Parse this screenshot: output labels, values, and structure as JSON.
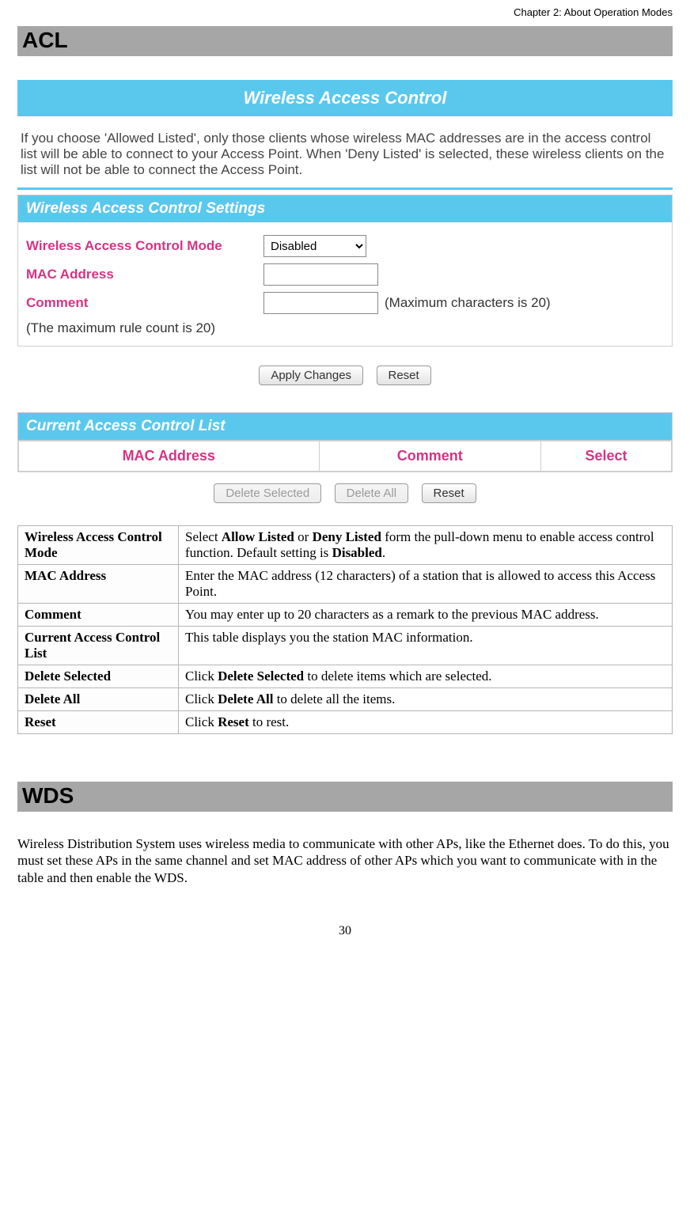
{
  "chapter": "Chapter 2: About Operation Modes",
  "sections": {
    "acl_heading": "ACL",
    "wds_heading": "WDS"
  },
  "figure": {
    "banner_title": "Wireless Access Control",
    "intro": "If you choose 'Allowed Listed', only those clients whose wireless MAC addresses are in the access control list will be able to connect to your Access Point. When 'Deny Listed' is selected, these wireless clients on the list will not be able to connect the Access Point.",
    "settings_panel_title": "Wireless Access Control Settings",
    "rows": {
      "mode_label": "Wireless Access Control Mode",
      "mode_value": "Disabled",
      "mac_label": "MAC Address",
      "mac_value": "",
      "comment_label": "Comment",
      "comment_value": "",
      "comment_hint": "(Maximum characters is 20)"
    },
    "rule_note": "(The maximum rule count is 20)",
    "buttons": {
      "apply": "Apply Changes",
      "reset": "Reset"
    },
    "list_panel_title": "Current Access Control List",
    "list_columns": {
      "mac": "MAC Address",
      "comment": "Comment",
      "select": "Select"
    },
    "list_buttons": {
      "delete_selected": "Delete Selected",
      "delete_all": "Delete All",
      "reset": "Reset"
    }
  },
  "desc_table": {
    "r1k": "Wireless Access Control Mode",
    "r1v_pre": "Select ",
    "r1v_b1": "Allow Listed",
    "r1v_mid1": " or ",
    "r1v_b2": "Deny Listed",
    "r1v_mid2": " form the pull-down menu to enable access control function. Default setting is ",
    "r1v_b3": "Disabled",
    "r1v_end": ".",
    "r2k": "MAC Address",
    "r2v": "Enter the MAC address (12 characters)  of a station that is allowed to access this Access Point.",
    "r3k": "Comment",
    "r3v": "You may enter up to 20 characters as a remark to the previous MAC address.",
    "r4k": "Current Access Control List",
    "r4v": "This table displays you the station MAC information.",
    "r5k": "Delete Selected",
    "r5v_pre": "Click  ",
    "r5v_b": "Delete Selected",
    "r5v_end": " to delete items which are selected.",
    "r6k": "Delete All",
    "r6v_pre": "Click  ",
    "r6v_b": "Delete All",
    "r6v_end": " to delete all the items.",
    "r7k": "Reset",
    "r7v_pre": "Click  ",
    "r7v_b": "Reset",
    "r7v_end": " to rest."
  },
  "wds_paragraph": "Wireless Distribution System uses wireless media to communicate with other APs, like the Ethernet does. To do this, you must set these APs in the same channel and set MAC address of other APs which you want to communicate with in the table and then enable the WDS.",
  "page_number": "30"
}
